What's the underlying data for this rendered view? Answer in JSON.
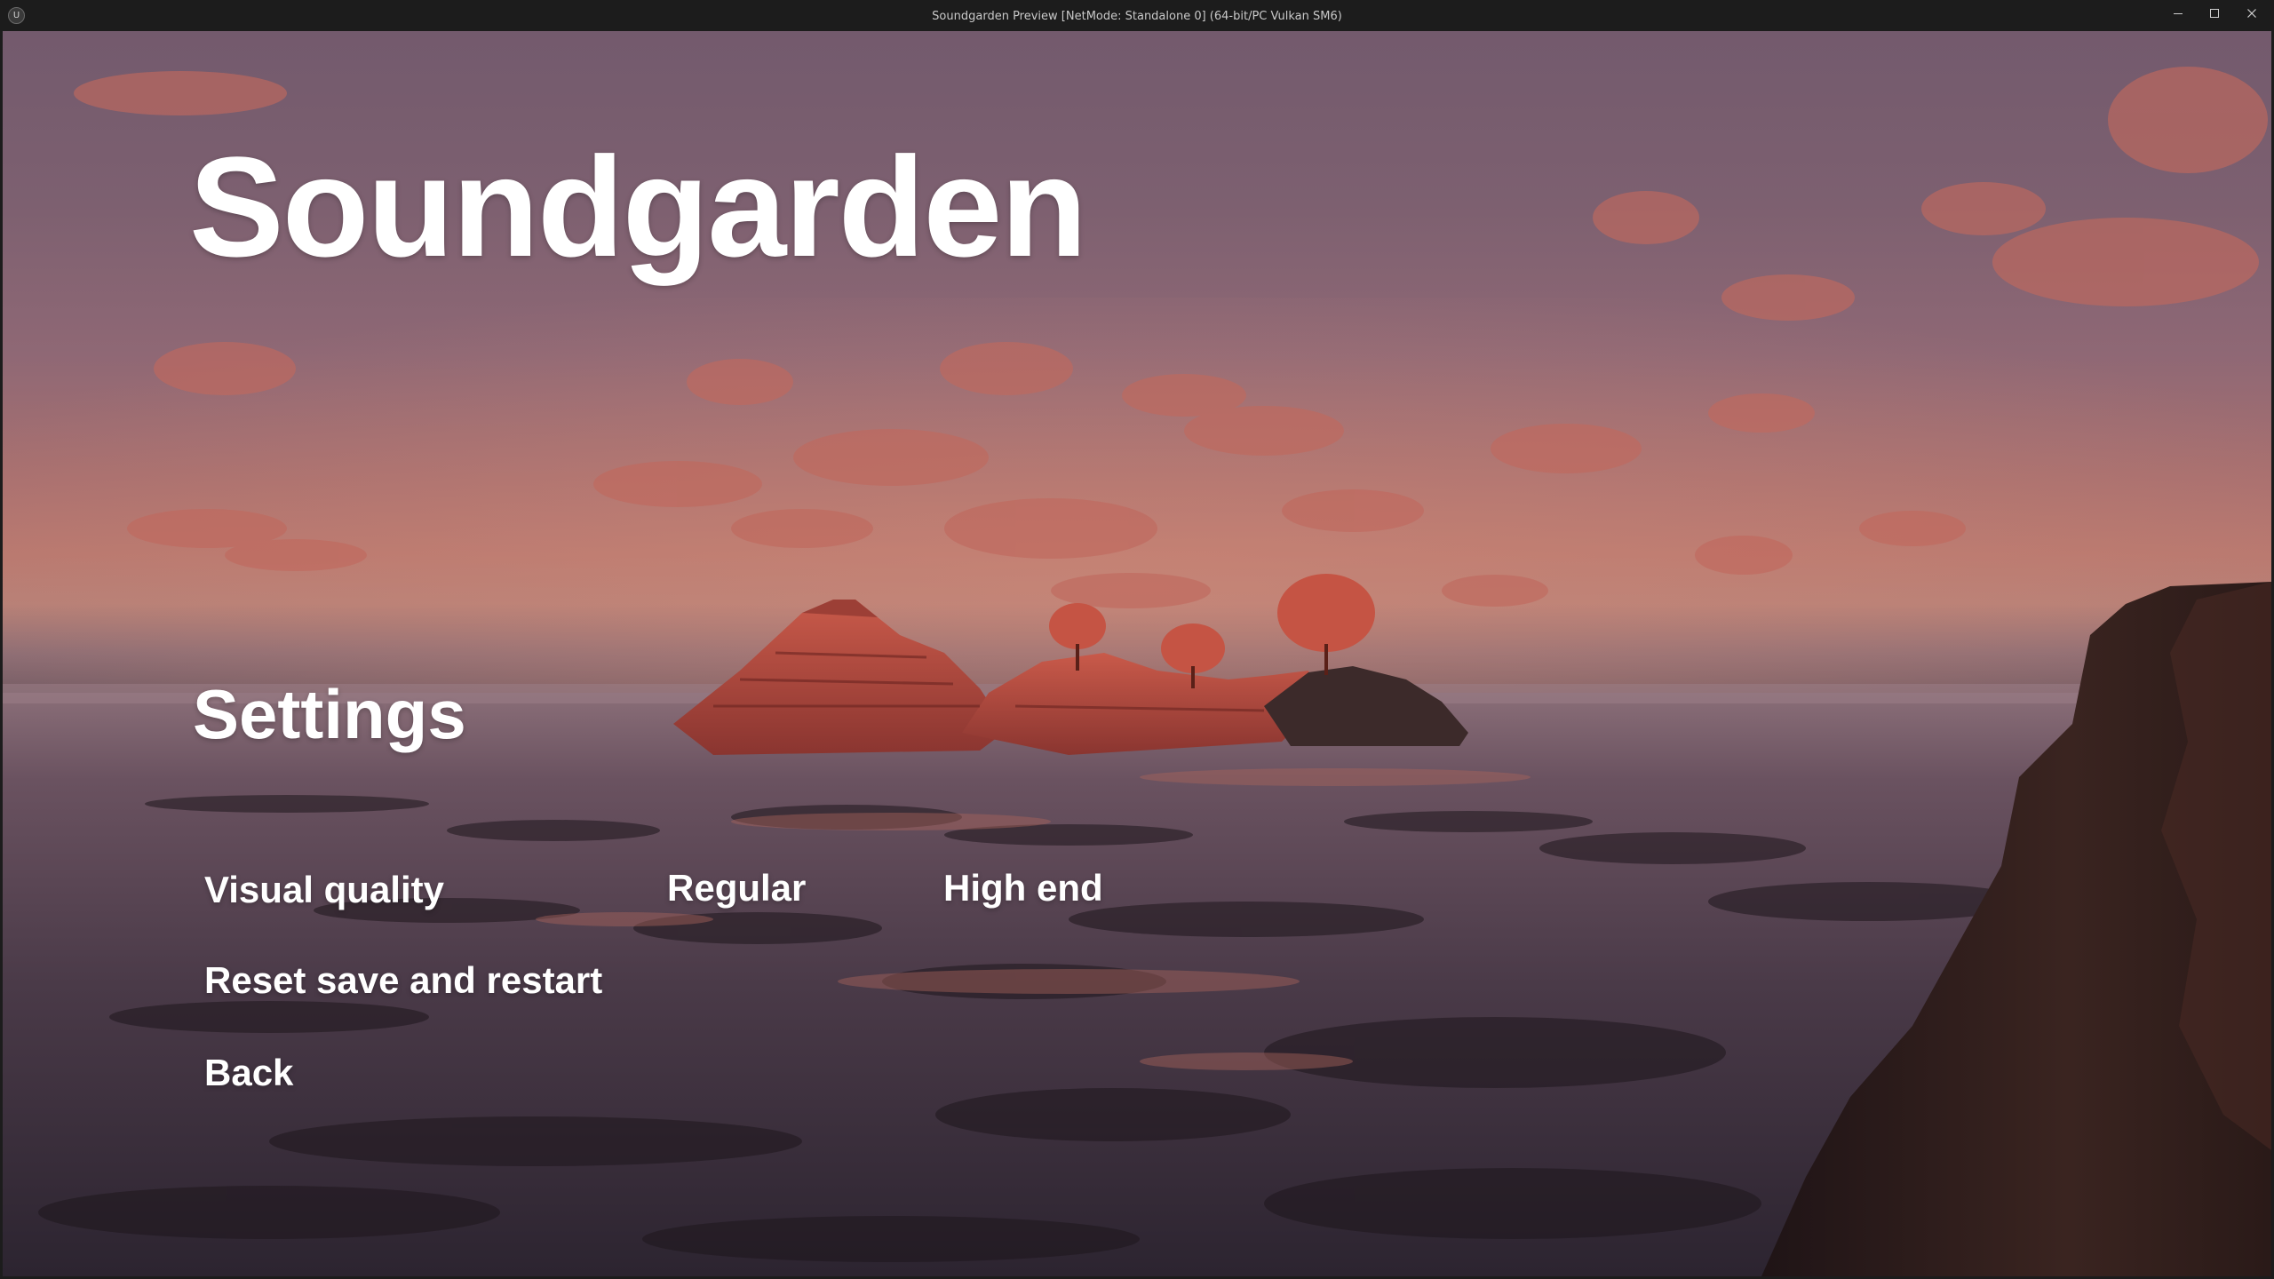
{
  "window": {
    "title": "Soundgarden Preview [NetMode: Standalone 0]  (64-bit/PC Vulkan SM6)",
    "app_icon": "U",
    "controls": {
      "minimize_icon": "minimize-icon",
      "maximize_icon": "maximize-icon",
      "close_icon": "close-icon"
    }
  },
  "game": {
    "title": "Soundgarden",
    "menu": {
      "heading": "Settings",
      "visual_quality_label": "Visual quality",
      "quality_options": [
        "Regular",
        "High end"
      ],
      "selected_quality": "Regular",
      "reset_label": "Reset save and restart",
      "back_label": "Back"
    }
  },
  "colors": {
    "sky_top": "#735a6d",
    "horizon_glow": "#b8786f",
    "island": "#b5473c",
    "water_dark": "#2a2330",
    "text": "#ffffff",
    "titlebar": "#1c1c1c"
  }
}
